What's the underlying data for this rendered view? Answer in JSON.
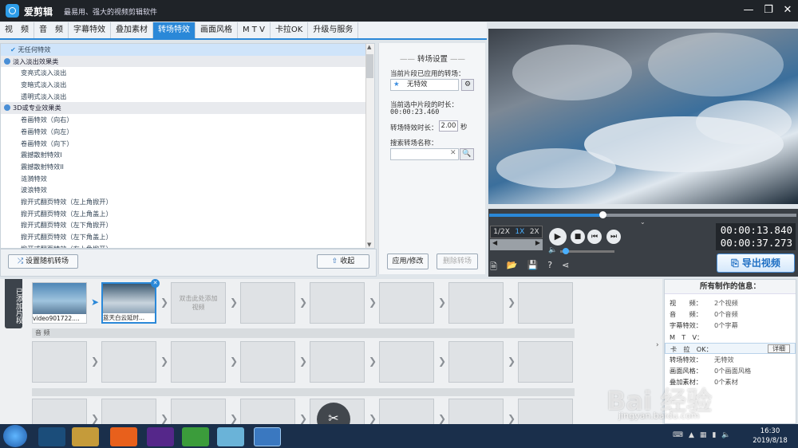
{
  "app": {
    "title": "爱剪辑",
    "slogan": "最易用、强大的视频剪辑软件"
  },
  "tabs": [
    "视　频",
    "音　频",
    "字幕特效",
    "叠加素材",
    "转场特效",
    "画面风格",
    "M T V",
    "卡拉OK",
    "升级与服务"
  ],
  "active_tab": "转场特效",
  "effects": [
    {
      "type": "selected",
      "label": "无任何特效"
    },
    {
      "type": "category",
      "label": "淡入淡出效果类"
    },
    {
      "type": "item",
      "label": "变亮式淡入淡出"
    },
    {
      "type": "item",
      "label": "变暗式淡入淡出"
    },
    {
      "type": "item",
      "label": "透明式淡入淡出"
    },
    {
      "type": "category",
      "label": "3D或专业效果类"
    },
    {
      "type": "item",
      "label": "卷画特效（向右）"
    },
    {
      "type": "item",
      "label": "卷画特效（向左）"
    },
    {
      "type": "item",
      "label": "卷画特效（向下）"
    },
    {
      "type": "item",
      "label": "震撼散射特效I"
    },
    {
      "type": "item",
      "label": "震撼散射特效II"
    },
    {
      "type": "item",
      "label": "涟漪特效"
    },
    {
      "type": "item",
      "label": "波浪特效"
    },
    {
      "type": "item",
      "label": "掀开式翻页特效（左上角掀开）"
    },
    {
      "type": "item",
      "label": "掀开式翻页特效（左上角盖上）"
    },
    {
      "type": "item",
      "label": "掀开式翻页特效（左下角掀开）"
    },
    {
      "type": "item",
      "label": "掀开式翻页特效（左下角盖上）"
    },
    {
      "type": "item",
      "label": "掀开式翻页特效（右上角掀开）"
    }
  ],
  "bottom_buttons": {
    "random": "设置随机转场",
    "collapse": "收起"
  },
  "settings": {
    "title": "转场设置",
    "applied_label": "当前片段已应用的转场：",
    "applied_value": "无特效",
    "duration_label": "当前选中片段的时长：",
    "duration_value": "00:00:23.460",
    "effect_duration_label": "转场特效时长：",
    "effect_duration_value": "2.00",
    "effect_duration_unit": "秒",
    "search_label": "搜索转场名称：",
    "search_value": "",
    "apply_button": "应用/修改",
    "delete_button": "删除转场"
  },
  "player": {
    "speeds": [
      "1/2X",
      "1X",
      "2X"
    ],
    "current_time": "00:00:13.840",
    "total_time": "00:00:37.273",
    "progress": 0.37,
    "volume": 0.1,
    "export_button": "导出视频"
  },
  "timeline": {
    "side_label": "已添加片段",
    "clips": [
      {
        "name": "video901722...."
      },
      {
        "name": "蓝天白云延时..."
      }
    ],
    "add_hint": "双击此处添加视频",
    "audio_label": "音 频"
  },
  "info_panel": {
    "title": "所有制作的信息：",
    "rows": [
      {
        "key": "视　　频：",
        "value": "2个视频"
      },
      {
        "key": "音　　频：",
        "value": "0个音频"
      },
      {
        "key": "字幕特效：",
        "value": "0个字幕"
      },
      {
        "key": "M　T　V：",
        "value": ""
      },
      {
        "key": "卡　拉　OK：",
        "value": "",
        "button": "详细"
      },
      {
        "key": "转场特效：",
        "value": "无特效"
      },
      {
        "key": "画面风格：",
        "value": "0个画面风格"
      },
      {
        "key": "叠加素材：",
        "value": "0个素材"
      }
    ]
  },
  "watermark": {
    "brand": "Bai 经验",
    "url": "jingyan.baidu.com"
  },
  "clock": {
    "time": "16:30",
    "date": "2019/8/18"
  },
  "colors": {
    "accent": "#2a88d8",
    "titlebar": "#1f2328",
    "taskbar": "#1a2f4b"
  }
}
